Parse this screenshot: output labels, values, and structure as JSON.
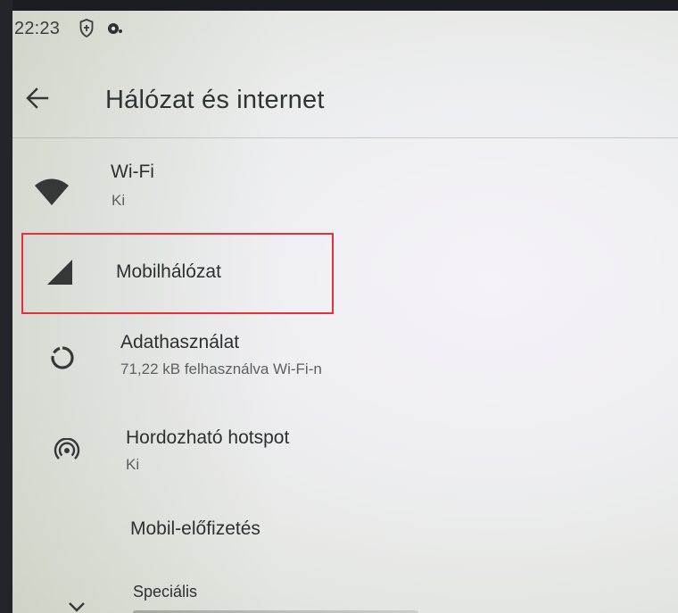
{
  "status_bar": {
    "time": "22:23",
    "icons": [
      "shield-icon",
      "record-icon"
    ]
  },
  "app_bar": {
    "back_icon": "arrow-back-icon",
    "title": "Hálózat és internet"
  },
  "items": [
    {
      "title": "Wi-Fi",
      "subtitle": "Ki",
      "icon": "wifi-icon"
    },
    {
      "title": "Mobilhálózat",
      "subtitle": "",
      "icon": "signal-icon",
      "highlighted": true
    },
    {
      "title": "Adathasználat",
      "subtitle": "71,22 kB felhasználva Wi-Fi-n",
      "icon": "data-usage-icon"
    },
    {
      "title": "Hordozható hotspot",
      "subtitle": "Ki",
      "icon": "hotspot-icon"
    },
    {
      "title": "Mobil-előfizetés",
      "subtitle": "",
      "icon": ""
    },
    {
      "title": "Speciális",
      "subtitle": "",
      "icon": "expand-icon"
    }
  ],
  "colors": {
    "highlight": "#e3303a",
    "text_primary": "#2d302f",
    "text_secondary": "#5c605e"
  }
}
